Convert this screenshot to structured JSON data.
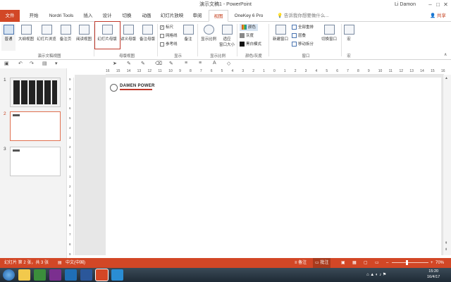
{
  "window": {
    "title": "演示文稿1 - PowerPoint",
    "user": "Li Damon",
    "restore": "□"
  },
  "tabs": [
    "文件",
    "开始",
    "Nordri Tools",
    "插入",
    "设计",
    "切换",
    "动画",
    "幻灯片放映",
    "审阅",
    "视图",
    "OneKey 6 Pro"
  ],
  "tellme": "告诉我你想要做什么...",
  "share": "共享",
  "ribbon": {
    "views": [
      "普通",
      "大纲视图",
      "幻灯片浏览",
      "备注页",
      "阅读视图"
    ],
    "masters": [
      "幻灯片母版",
      "讲义母版",
      "备注母版"
    ],
    "show": {
      "ruler": "标尺",
      "gridlines": "网格线",
      "guides": "参考线",
      "notes": "备注"
    },
    "zoom": {
      "zoom": "显示比例",
      "fit": "适应",
      "fit2": "窗口大小"
    },
    "color": {
      "color": "颜色",
      "gray": "灰度",
      "bw": "黑白模式"
    },
    "window": {
      "new": "新建窗口",
      "arrange": "全部重排",
      "cascade": "层叠",
      "split": "移动拆分",
      "switch": "切换窗口"
    },
    "macros": "宏",
    "group_labels": [
      "演示文稿视图",
      "母版视图",
      "显示",
      "显示比例",
      "颜色/灰度",
      "窗口",
      "宏"
    ]
  },
  "ruler": {
    "marks": [
      "16",
      "15",
      "14",
      "13",
      "12",
      "11",
      "10",
      "9",
      "8",
      "7",
      "6",
      "5",
      "4",
      "3",
      "2",
      "1",
      "0",
      "1",
      "2",
      "3",
      "4",
      "5",
      "6",
      "7",
      "8",
      "9",
      "10",
      "11",
      "12",
      "13",
      "14",
      "15",
      "16"
    ]
  },
  "vruler": {
    "marks": [
      "9",
      "8",
      "7",
      "6",
      "5",
      "4",
      "3",
      "2",
      "1",
      "0",
      "1",
      "2",
      "3",
      "4",
      "5",
      "6",
      "7",
      "8",
      "9"
    ]
  },
  "slides": [
    {
      "num": "1"
    },
    {
      "num": "2"
    },
    {
      "num": "3"
    }
  ],
  "slide": {
    "brand": "DAMEN POWER"
  },
  "status": {
    "slide": "幻灯片 第 2 张，共 3 张",
    "lang": "中文(中国)",
    "notes": "备注",
    "comments": "批注",
    "zoom": "70%"
  },
  "clock": {
    "time": "15:20",
    "date": "16/4/17"
  },
  "colors": {
    "accent": "#d24726"
  }
}
